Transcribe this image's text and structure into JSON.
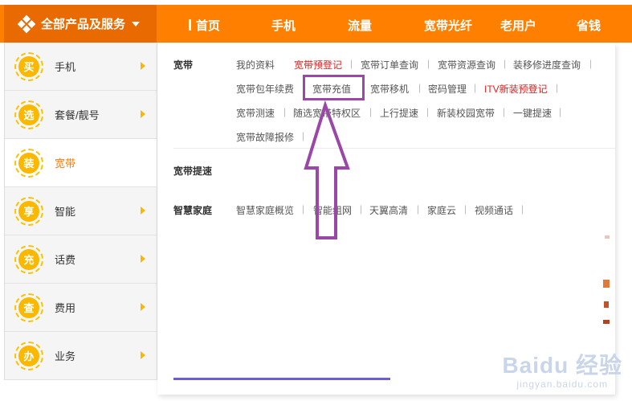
{
  "header": {
    "all_products_label": "全部产品及服务",
    "nav": [
      "首页",
      "手机",
      "流量",
      "宽带光纤",
      "老用户",
      "省钱"
    ]
  },
  "sidebar": {
    "items": [
      {
        "badge": "买",
        "label": "手机",
        "active": false
      },
      {
        "badge": "选",
        "label": "套餐/靓号",
        "active": false
      },
      {
        "badge": "装",
        "label": "宽带",
        "active": true
      },
      {
        "badge": "享",
        "label": "智能",
        "active": false
      },
      {
        "badge": "充",
        "label": "话费",
        "active": false
      },
      {
        "badge": "查",
        "label": "费用",
        "active": false
      },
      {
        "badge": "办",
        "label": "业务",
        "active": false
      }
    ]
  },
  "panel": {
    "sections": [
      {
        "title": "宽带",
        "links": [
          "我的资料",
          "宽带预登记",
          "宽带订单查询",
          "宽带资源查询",
          "装移修进度查询",
          "宽带包年续费",
          "宽带充值",
          "宽带移机",
          "密码管理",
          "ITV新装预登记",
          "宽带测速",
          "随选宽带特权区",
          "上行提速",
          "新装校园宽带",
          "一键提速",
          "宽带故障报修"
        ]
      },
      {
        "title": "宽带提速",
        "links": []
      },
      {
        "title": "智慧家庭",
        "links": [
          "智慧家庭概览",
          "智能组网",
          "天翼高清",
          "家庭云",
          "视频通话"
        ]
      }
    ]
  },
  "annotation": {
    "highlight_color": "#9b47a8",
    "highlighted_item": "宽带充值"
  },
  "watermark": {
    "main": "Baidu 经验",
    "sub": "jingyan.baidu.com"
  },
  "colors": {
    "brand_orange": "#ff8000",
    "badge_yellow": "#fbb800",
    "red_link": "#e61e1e"
  }
}
